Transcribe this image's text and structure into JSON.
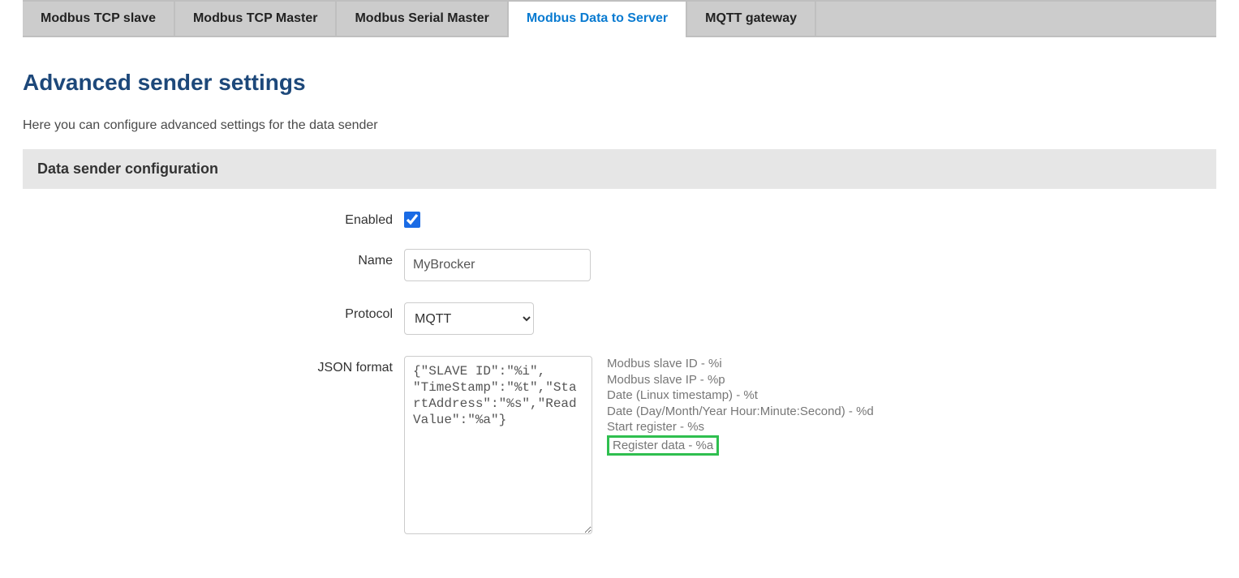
{
  "tabs": [
    {
      "label": "Modbus TCP slave",
      "active": false
    },
    {
      "label": "Modbus TCP Master",
      "active": false
    },
    {
      "label": "Modbus Serial Master",
      "active": false
    },
    {
      "label": "Modbus Data to Server",
      "active": true
    },
    {
      "label": "MQTT gateway",
      "active": false
    }
  ],
  "page_title": "Advanced sender settings",
  "page_desc": "Here you can configure advanced settings for the data sender",
  "section_header": "Data sender configuration",
  "form": {
    "enabled_label": "Enabled",
    "enabled_value": true,
    "name_label": "Name",
    "name_value": "MyBrocker",
    "protocol_label": "Protocol",
    "protocol_value": "MQTT",
    "protocol_options": [
      "MQTT"
    ],
    "json_label": "JSON format",
    "json_value": "{\"SLAVE ID\":\"%i\", \"TimeStamp\":\"%t\",\"StartAddress\":\"%s\",\"Read Value\":\"%a\"}",
    "hints": [
      {
        "text": "Modbus slave ID - %i",
        "boxed": false
      },
      {
        "text": "Modbus slave IP - %p",
        "boxed": false
      },
      {
        "text": "Date (Linux timestamp) - %t",
        "boxed": false
      },
      {
        "text": "Date (Day/Month/Year Hour:Minute:Second) - %d",
        "boxed": false
      },
      {
        "text": "Start register - %s",
        "boxed": false
      },
      {
        "text": "Register data - %a",
        "boxed": true
      }
    ]
  }
}
